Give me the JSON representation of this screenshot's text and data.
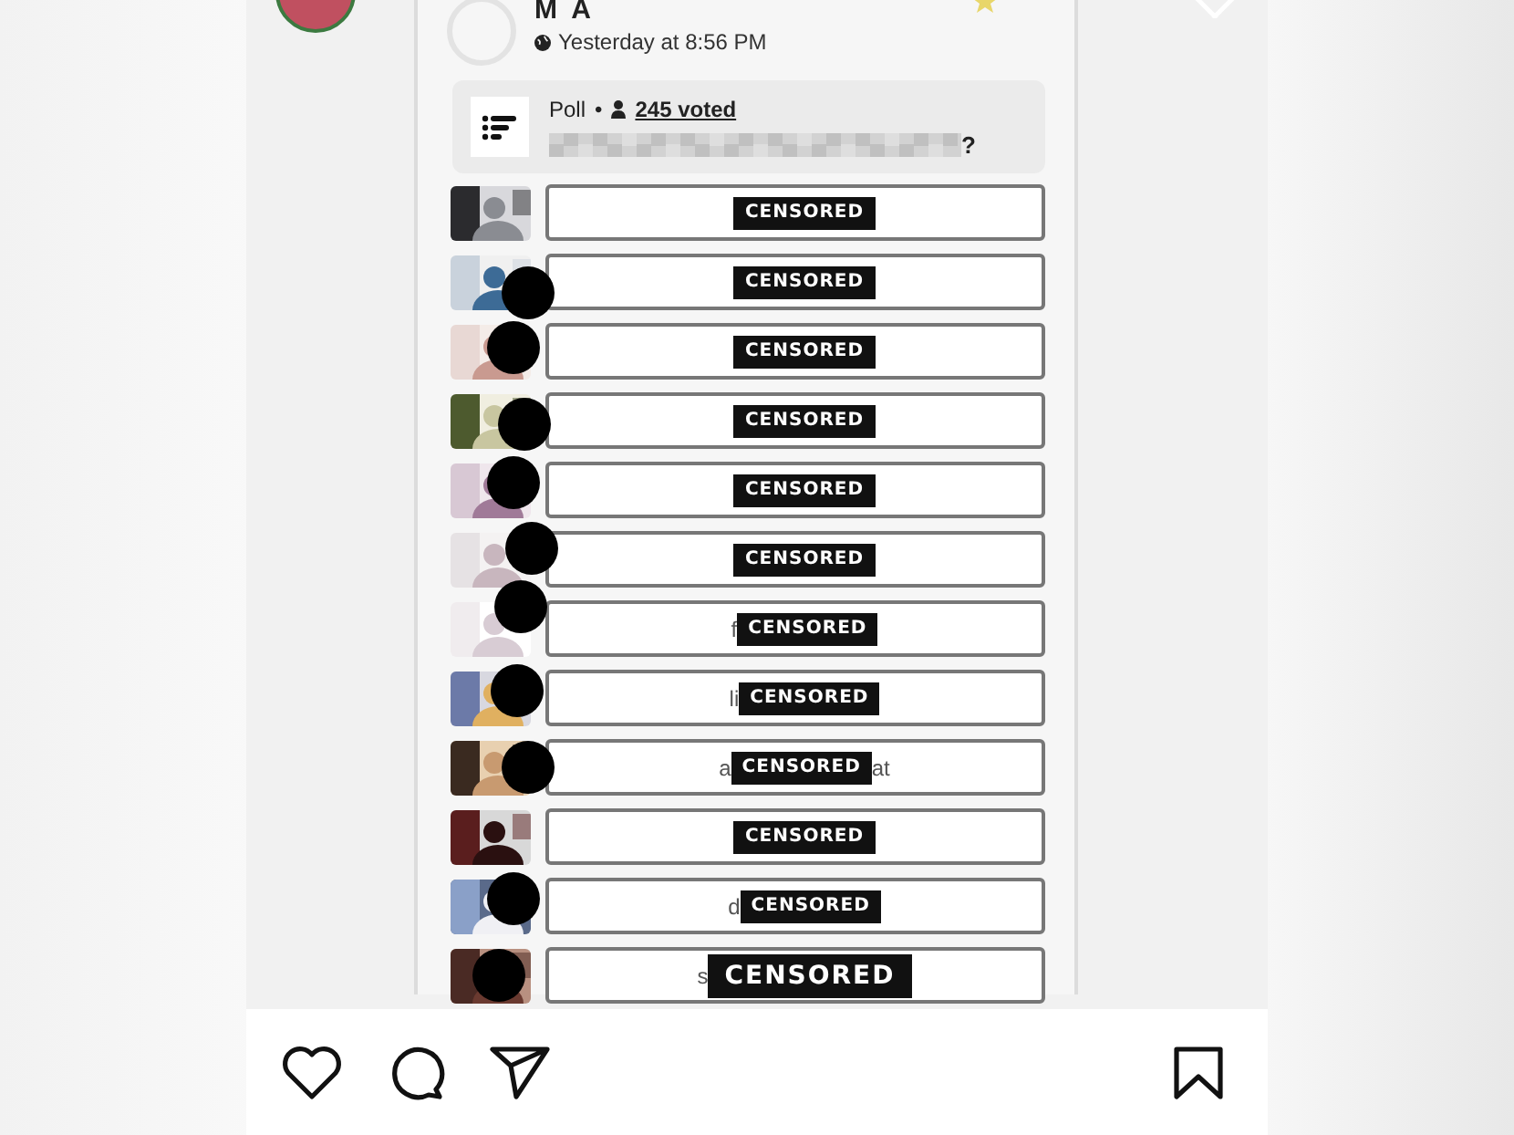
{
  "post": {
    "author": "M A",
    "time": "Yesterday at 8:56 PM",
    "starred": true
  },
  "poll": {
    "label": "Poll",
    "separator": "•",
    "votes": "245 voted",
    "question_end": "?"
  },
  "options": [
    {
      "label": "CENSORED",
      "redacted": false,
      "large": false
    },
    {
      "label": "CENSORED",
      "redacted": true,
      "large": false
    },
    {
      "label": "CENSORED",
      "redacted": true,
      "large": false
    },
    {
      "label": "CENSORED",
      "redacted": true,
      "large": false
    },
    {
      "label": "CENSORED",
      "redacted": true,
      "large": false
    },
    {
      "label": "CENSORED",
      "redacted": true,
      "large": false
    },
    {
      "prefix": "f",
      "label": "CENSORED",
      "redacted": true,
      "large": false
    },
    {
      "prefix": "li",
      "label": "CENSORED",
      "redacted": true,
      "large": false
    },
    {
      "prefix": "a",
      "label": "CENSORED",
      "suffix": "at",
      "redacted": true,
      "large": false
    },
    {
      "label": "CENSORED",
      "redacted": false,
      "large": false
    },
    {
      "prefix": "d",
      "label": "CENSORED",
      "redacted": true,
      "large": false
    },
    {
      "prefix": "s",
      "label": "CENSORED",
      "redacted": true,
      "large": true
    }
  ]
}
